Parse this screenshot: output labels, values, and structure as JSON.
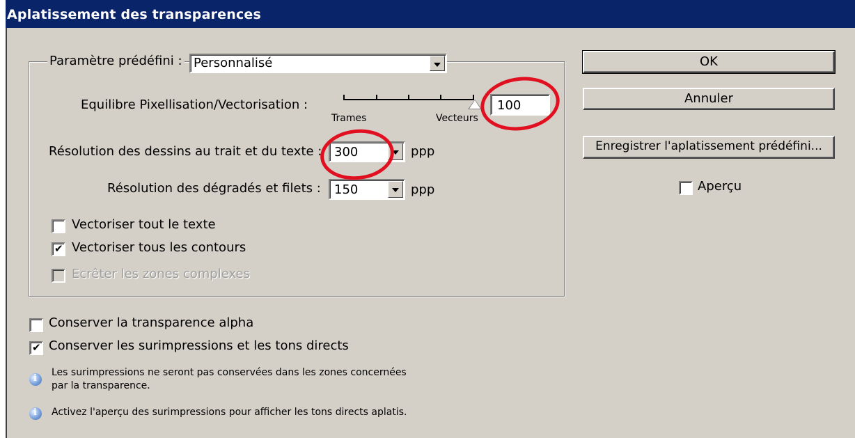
{
  "window": {
    "title": "Aplatissement des transparences"
  },
  "preset": {
    "label": "Paramètre prédéfini :",
    "value": "Personnalisé"
  },
  "balance": {
    "label": "Equilibre Pixellisation/Vectorisation :",
    "min_label": "Trames",
    "max_label": "Vecteurs",
    "value": "100",
    "slider_level_percent": 100
  },
  "line_art_resolution": {
    "label": "Résolution des dessins au trait et du texte :",
    "value": "300",
    "unit": "ppp"
  },
  "gradient_resolution": {
    "label": "Résolution des dégradés et filets :",
    "value": "150",
    "unit": "ppp"
  },
  "options": [
    {
      "label": "Vectoriser tout le texte",
      "checked": false,
      "enabled": true
    },
    {
      "label": "Vectoriser tous les contours",
      "checked": true,
      "enabled": true
    },
    {
      "label": "Ecrêter les zones complexes",
      "checked": false,
      "enabled": false
    }
  ],
  "bottom_options": [
    {
      "label": "Conserver la transparence alpha",
      "checked": false
    },
    {
      "label": "Conserver les surimpressions et les tons directs",
      "checked": true
    }
  ],
  "info": [
    {
      "line1": "Les surimpressions ne seront pas conservées dans les zones concernées",
      "line2": "par la transparence."
    },
    {
      "line1": "Activez l'aperçu des surimpressions pour afficher les tons directs aplatis."
    }
  ],
  "buttons": {
    "ok": "OK",
    "cancel": "Annuler",
    "save_preset": "Enregistrer l'aplatissement prédéfini..."
  },
  "preview": {
    "label": "Aperçu",
    "checked": false
  },
  "checkmark": "✔",
  "colors": {
    "titlebar": "#0a246a",
    "dialog_bg": "#d4d0c8",
    "annotation": "#e01020"
  }
}
